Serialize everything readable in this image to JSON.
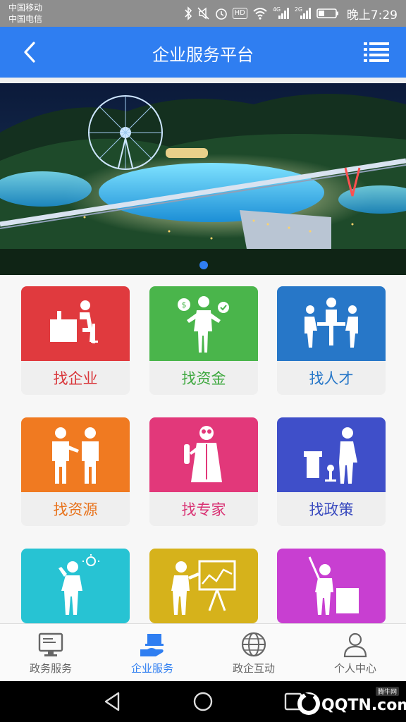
{
  "status_bar": {
    "carrier_1": "中国移动",
    "carrier_2": "中国电信",
    "network_1": "4G",
    "network_2": "2G",
    "hd_badge": "HD",
    "time": "晚上7:29"
  },
  "header": {
    "title": "企业服务平台",
    "back_icon": "chevron-left-icon",
    "menu_icon": "list-menu-icon"
  },
  "banner": {
    "slide_count": 1,
    "active_slide": 1
  },
  "services": [
    {
      "label": "找企业",
      "color": "#e03a3e",
      "label_color": "#d9383c",
      "icon": "person-at-desk-icon"
    },
    {
      "label": "找资金",
      "color": "#4ab54b",
      "label_color": "#3ea83f",
      "icon": "person-with-money-icon"
    },
    {
      "label": "找人才",
      "color": "#2777c8",
      "label_color": "#2777c8",
      "icon": "meeting-people-icon"
    },
    {
      "label": "找资源",
      "color": "#f07a21",
      "label_color": "#e8731c",
      "icon": "two-people-talking-icon"
    },
    {
      "label": "找专家",
      "color": "#e2387a",
      "label_color": "#d93173",
      "icon": "expert-doctor-icon"
    },
    {
      "label": "找政策",
      "color": "#3f4fc9",
      "label_color": "#3a4bbf",
      "icon": "person-at-podium-icon"
    },
    {
      "label": "",
      "color": "#27c3d3",
      "label_color": "#27c3d3",
      "icon": "person-with-idea-icon"
    },
    {
      "label": "",
      "color": "#d6b21b",
      "label_color": "#d6b21b",
      "icon": "person-presenting-chart-icon"
    },
    {
      "label": "",
      "color": "#c83fd1",
      "label_color": "#c83fd1",
      "icon": "person-teaching-board-icon"
    }
  ],
  "tabs": [
    {
      "label": "政务服务",
      "icon": "monitor-icon",
      "active": false
    },
    {
      "label": "企业服务",
      "icon": "hand-laptop-icon",
      "active": true
    },
    {
      "label": "政企互动",
      "icon": "globe-icon",
      "active": false
    },
    {
      "label": "个人中心",
      "icon": "user-icon",
      "active": false
    }
  ],
  "colors": {
    "primary": "#2f7ef1",
    "status_bar": "#8e8e8e"
  },
  "watermark": {
    "text": "QQTN.com",
    "sub": "腾牛网"
  }
}
